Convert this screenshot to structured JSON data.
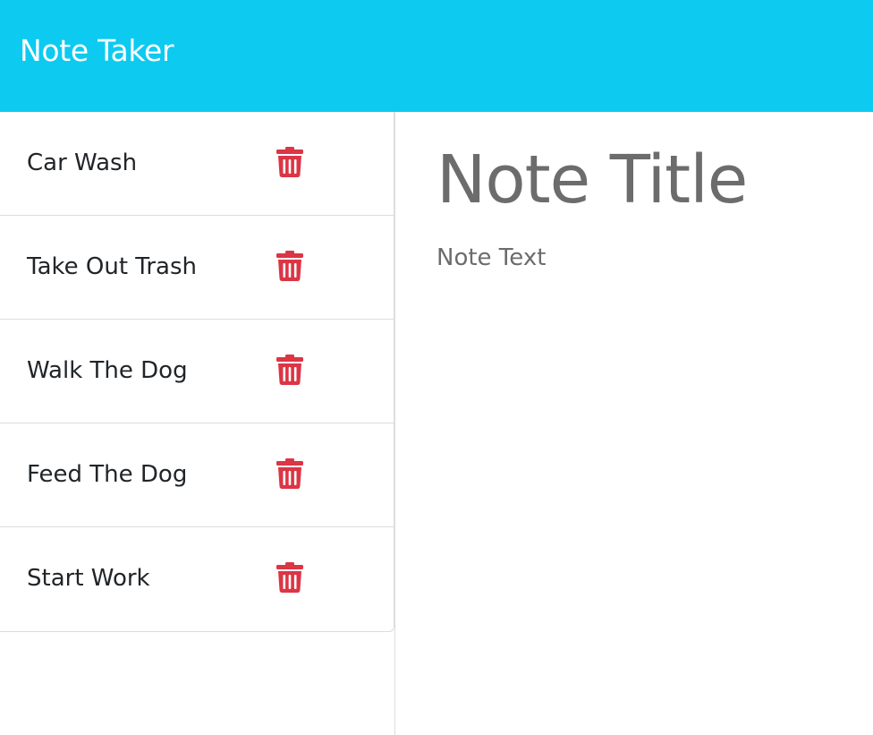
{
  "app": {
    "title": "Note Taker",
    "accent_color": "#0dcaf0",
    "delete_color": "#dc3545"
  },
  "notes": [
    {
      "title": "Car Wash",
      "icon": "trash-icon"
    },
    {
      "title": "Take Out Trash",
      "icon": "trash-icon"
    },
    {
      "title": "Walk The Dog",
      "icon": "trash-icon"
    },
    {
      "title": "Feed The Dog",
      "icon": "trash-icon"
    },
    {
      "title": "Start Work",
      "icon": "trash-icon"
    }
  ],
  "editor": {
    "title_placeholder": "Note Title",
    "title_value": "",
    "text_placeholder": "Note Text",
    "text_value": ""
  }
}
